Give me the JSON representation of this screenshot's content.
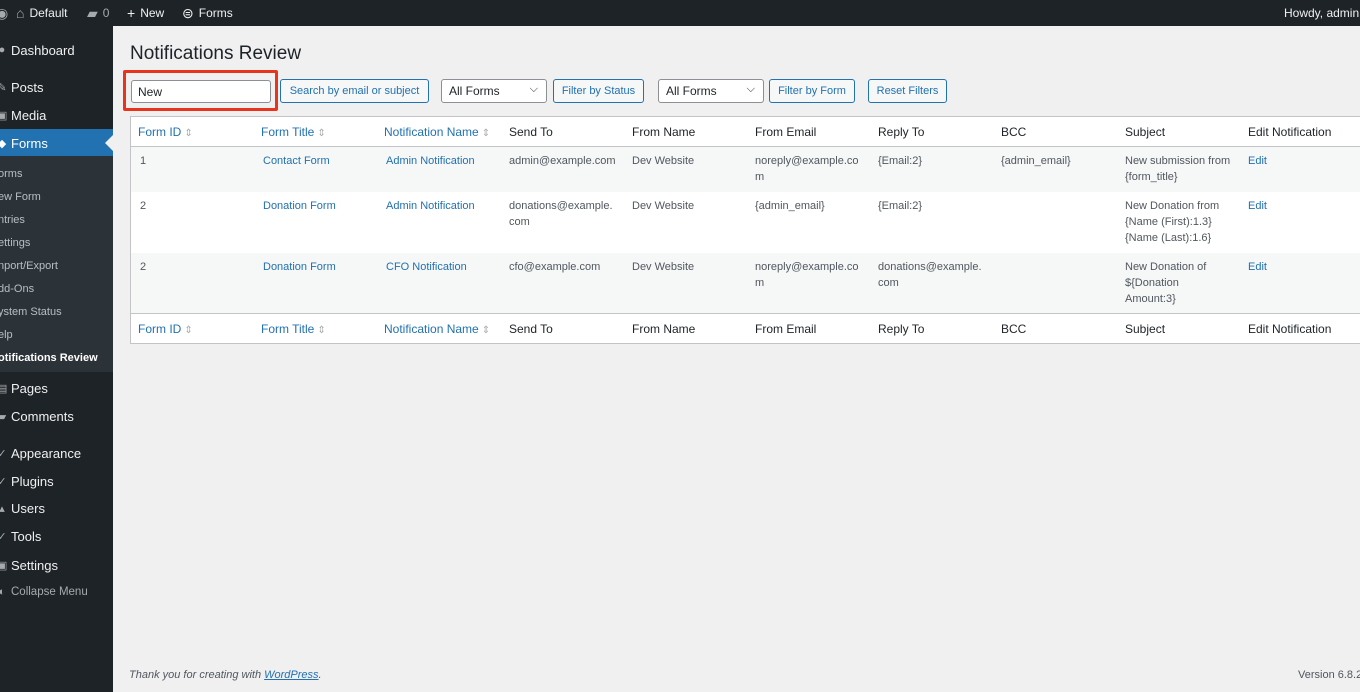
{
  "adminbar": {
    "site_name": "Default",
    "comments_count": "0",
    "new_label": "New",
    "forms_label": "Forms",
    "howdy": "Howdy, admin"
  },
  "menu": {
    "dashboard": "Dashboard",
    "posts": "Posts",
    "media": "Media",
    "forms": "Forms",
    "submenu": [
      "orms",
      "ew Form",
      "ntries",
      "ettings",
      "nport/Export",
      "dd-Ons",
      "ystem Status",
      "elp",
      "otifications Review"
    ],
    "pages": "Pages",
    "comments": "Comments",
    "appearance": "Appearance",
    "plugins": "Plugins",
    "users": "Users",
    "tools": "Tools",
    "settings": "Settings",
    "collapse": "Collapse Menu"
  },
  "page": {
    "title": "Notifications Review",
    "search_value": "New",
    "search_button": "Search by email or subject",
    "status_select": "All Forms",
    "filter_status_button": "Filter by Status",
    "form_select": "All Forms",
    "filter_form_button": "Filter by Form",
    "reset_button": "Reset Filters"
  },
  "table": {
    "columns": [
      "Form ID",
      "Form Title",
      "Notification Name",
      "Send To",
      "From Name",
      "From Email",
      "Reply To",
      "BCC",
      "Subject",
      "Edit Notification"
    ],
    "rows": [
      {
        "form_id": "1",
        "form_title": "Contact Form",
        "notification_name": "Admin Notification",
        "send_to": [
          "admin@example.com"
        ],
        "from_name": "Dev Website",
        "from_email": [
          "noreply@example.co",
          "m"
        ],
        "reply_to": [
          "{Email:2}"
        ],
        "bcc": "{admin_email}",
        "subject": [
          "New submission from",
          "{form_title}"
        ],
        "edit": "Edit"
      },
      {
        "form_id": "2",
        "form_title": "Donation Form",
        "notification_name": "Admin Notification",
        "send_to": [
          "donations@example.",
          "com"
        ],
        "from_name": "Dev Website",
        "from_email": [
          "{admin_email}"
        ],
        "reply_to": [
          "{Email:2}"
        ],
        "bcc": "",
        "subject": [
          "New Donation from",
          "{Name (First):1.3}",
          "{Name (Last):1.6}"
        ],
        "edit": "Edit"
      },
      {
        "form_id": "2",
        "form_title": "Donation Form",
        "notification_name": "CFO Notification",
        "send_to": [
          "cfo@example.com"
        ],
        "from_name": "Dev Website",
        "from_email": [
          "noreply@example.co",
          "m"
        ],
        "reply_to": [
          "donations@example.",
          "com"
        ],
        "bcc": "",
        "subject": [
          "New Donation of",
          "${Donation",
          "Amount:3}"
        ],
        "edit": "Edit"
      }
    ]
  },
  "footer": {
    "thanks_prefix": "Thank you for creating with ",
    "wordpress_link": "WordPress",
    "thanks_suffix": ".",
    "version": "Version 6.8.2"
  }
}
